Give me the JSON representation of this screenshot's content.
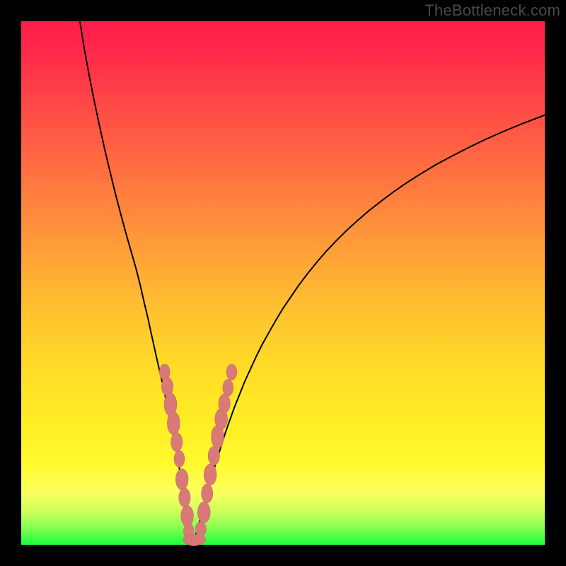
{
  "watermark": "TheBottleneck.com",
  "colors": {
    "frame": "#000000",
    "curve": "#000000",
    "marker_fill": "#d97a78",
    "marker_stroke": "#c76a68"
  },
  "chart_data": {
    "type": "line",
    "title": "",
    "xlabel": "",
    "ylabel": "",
    "xlim": [
      0,
      100
    ],
    "ylim": [
      0,
      100
    ],
    "grid": false,
    "legend": false,
    "series": [
      {
        "name": "left_branch",
        "x": [
          11.2,
          12.0,
          13.0,
          14.0,
          15.0,
          16.0,
          17.0,
          18.0,
          19.0,
          20.0,
          21.0,
          22.0,
          22.8,
          23.5,
          24.2,
          24.8,
          25.4,
          26.0,
          26.6,
          27.2,
          27.7,
          28.2,
          28.7,
          29.2,
          29.7,
          30.1,
          30.5,
          30.8,
          31.2,
          31.5,
          31.8,
          32.1
        ],
        "y": [
          100.0,
          95.0,
          89.5,
          84.5,
          79.8,
          75.3,
          71.1,
          67.0,
          63.2,
          59.5,
          56.0,
          52.5,
          49.3,
          46.2,
          43.3,
          40.5,
          37.8,
          35.1,
          32.5,
          29.9,
          27.4,
          25.0,
          22.5,
          20.1,
          17.6,
          15.2,
          12.8,
          10.4,
          7.9,
          5.5,
          3.1,
          0.9
        ]
      },
      {
        "name": "right_branch",
        "x": [
          33.0,
          33.7,
          34.4,
          35.1,
          35.8,
          36.5,
          37.3,
          38.1,
          38.9,
          39.8,
          40.7,
          41.7,
          42.7,
          43.8,
          44.9,
          46.1,
          47.4,
          48.7,
          50.1,
          51.6,
          53.1,
          54.7,
          56.4,
          58.2,
          60.1,
          62.1,
          64.2,
          66.4,
          68.7,
          71.1,
          73.7,
          76.4,
          79.2,
          82.2,
          85.3,
          88.6,
          92.0,
          95.6,
          99.3,
          100.0
        ],
        "y": [
          0.9,
          3.0,
          5.6,
          8.2,
          10.8,
          13.4,
          16.0,
          18.6,
          21.1,
          23.7,
          26.2,
          28.7,
          31.2,
          33.6,
          36.0,
          38.4,
          40.7,
          43.0,
          45.3,
          47.5,
          49.7,
          51.8,
          53.9,
          56.0,
          58.0,
          60.0,
          61.9,
          63.8,
          65.6,
          67.4,
          69.2,
          70.9,
          72.6,
          74.2,
          75.8,
          77.4,
          78.9,
          80.4,
          81.8,
          82.1
        ]
      },
      {
        "name": "valley_floor",
        "x": [
          32.0,
          32.3,
          32.6,
          32.9,
          33.2
        ],
        "y": [
          0.7,
          0.4,
          0.3,
          0.4,
          0.7
        ]
      }
    ],
    "markers": [
      {
        "x": 27.4,
        "y": 33.0,
        "rx": 1.0,
        "ry": 1.5
      },
      {
        "x": 27.9,
        "y": 30.2,
        "rx": 1.1,
        "ry": 1.8
      },
      {
        "x": 28.5,
        "y": 26.8,
        "rx": 1.2,
        "ry": 2.2
      },
      {
        "x": 29.1,
        "y": 23.2,
        "rx": 1.2,
        "ry": 2.2
      },
      {
        "x": 29.7,
        "y": 19.6,
        "rx": 1.1,
        "ry": 1.8
      },
      {
        "x": 30.2,
        "y": 16.4,
        "rx": 1.0,
        "ry": 1.6
      },
      {
        "x": 30.7,
        "y": 12.5,
        "rx": 1.2,
        "ry": 2.0
      },
      {
        "x": 31.2,
        "y": 9.0,
        "rx": 1.1,
        "ry": 1.8
      },
      {
        "x": 31.7,
        "y": 5.5,
        "rx": 1.2,
        "ry": 2.0
      },
      {
        "x": 32.0,
        "y": 2.6,
        "rx": 1.0,
        "ry": 1.4
      },
      {
        "x": 32.3,
        "y": 1.0,
        "rx": 1.4,
        "ry": 1.0
      },
      {
        "x": 33.0,
        "y": 0.8,
        "rx": 1.6,
        "ry": 1.0
      },
      {
        "x": 33.8,
        "y": 1.0,
        "rx": 1.4,
        "ry": 1.0
      },
      {
        "x": 34.3,
        "y": 3.0,
        "rx": 1.0,
        "ry": 1.4
      },
      {
        "x": 34.9,
        "y": 6.2,
        "rx": 1.2,
        "ry": 2.0
      },
      {
        "x": 35.5,
        "y": 9.8,
        "rx": 1.1,
        "ry": 1.8
      },
      {
        "x": 36.1,
        "y": 13.4,
        "rx": 1.2,
        "ry": 2.0
      },
      {
        "x": 36.8,
        "y": 17.0,
        "rx": 1.1,
        "ry": 1.8
      },
      {
        "x": 37.5,
        "y": 20.6,
        "rx": 1.2,
        "ry": 2.2
      },
      {
        "x": 38.2,
        "y": 24.0,
        "rx": 1.2,
        "ry": 2.0
      },
      {
        "x": 38.8,
        "y": 27.0,
        "rx": 1.1,
        "ry": 1.8
      },
      {
        "x": 39.5,
        "y": 30.0,
        "rx": 1.0,
        "ry": 1.6
      },
      {
        "x": 40.2,
        "y": 33.0,
        "rx": 1.0,
        "ry": 1.5
      }
    ]
  }
}
